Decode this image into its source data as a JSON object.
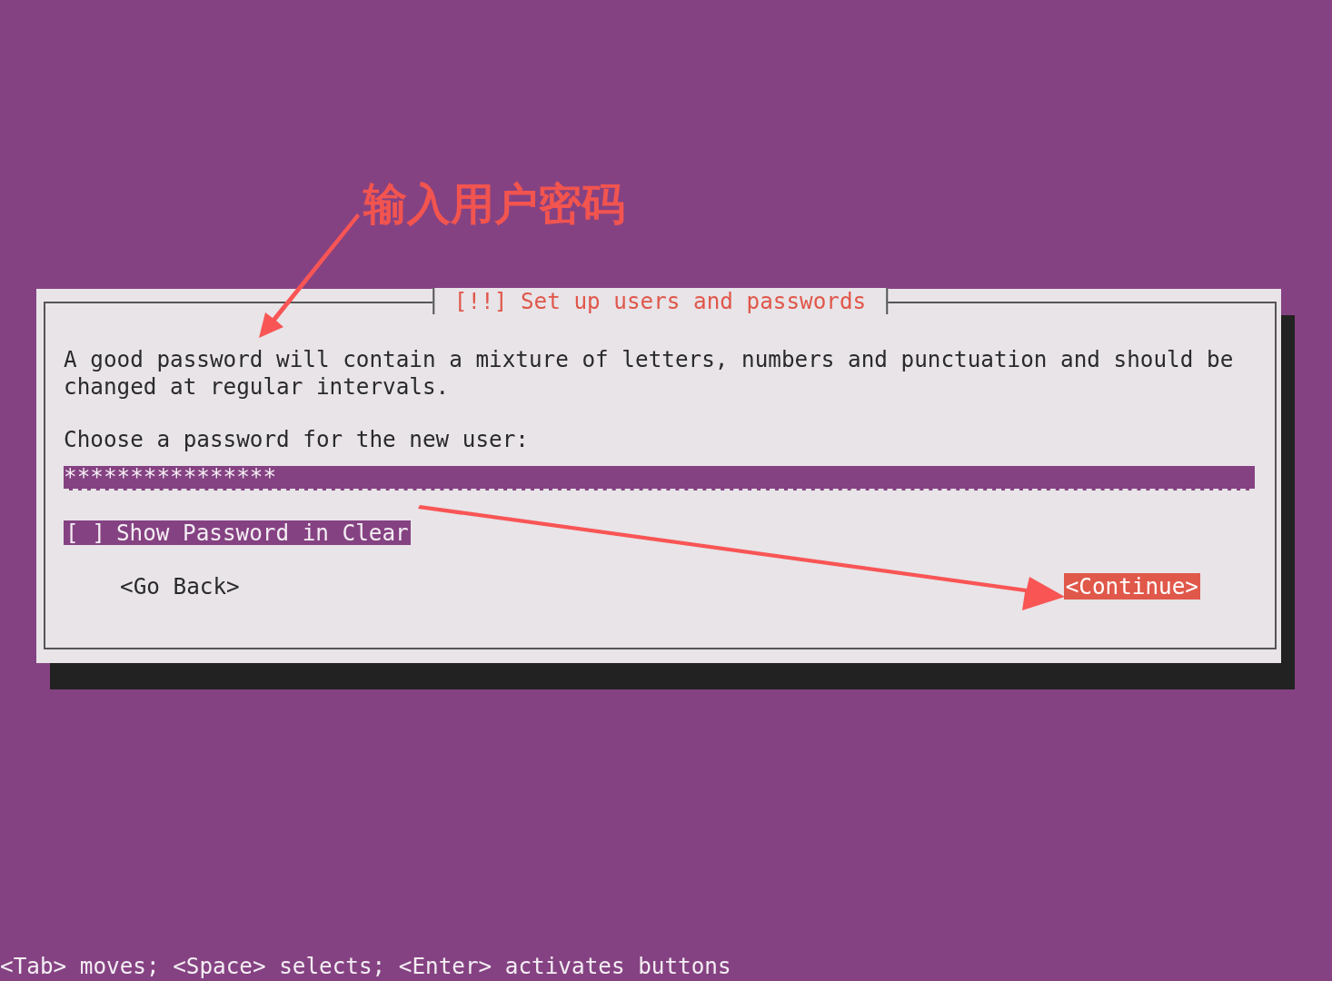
{
  "annotation": {
    "label": "输入用户密码"
  },
  "dialog": {
    "title": "[!!] Set up users and passwords",
    "description": "A good password will contain a mixture of letters, numbers and punctuation and should be changed at regular intervals.",
    "prompt": "Choose a password for the new user:",
    "password_field": {
      "value": "****************",
      "focused": true
    },
    "checkbox": {
      "box": "[ ]",
      "label": "Show Password in Clear",
      "checked": false,
      "focused": true
    },
    "buttons": [
      {
        "label": "<Go Back>",
        "selected": false
      },
      {
        "label": "<Continue>",
        "selected": true
      }
    ]
  },
  "status_bar": "<Tab> moves; <Space> selects; <Enter> activates buttons"
}
